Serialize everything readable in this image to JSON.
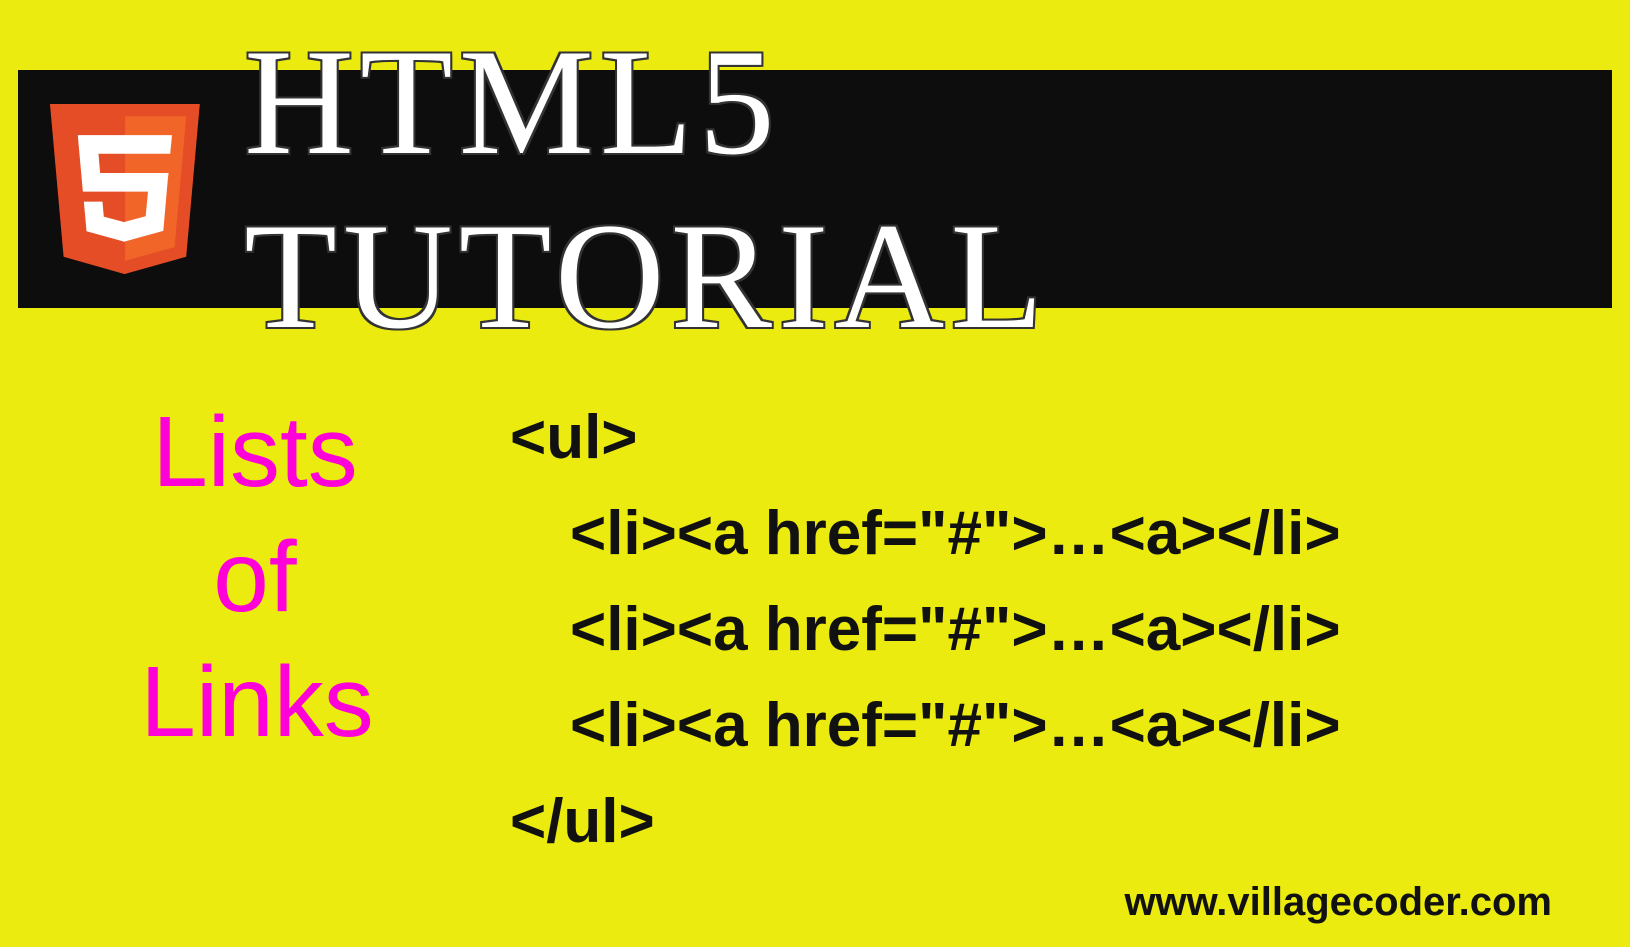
{
  "header": {
    "title": "HTML5 TUTORIAL",
    "logo_glyph": "5"
  },
  "subtitle": {
    "line1": "Lists",
    "line2": "of",
    "line3": "Links"
  },
  "code": {
    "open": "<ul>",
    "li1": "<li><a href=\"#\">…<a></li>",
    "li2": "<li><a href=\"#\">…<a></li>",
    "li3": "<li><a href=\"#\">…<a></li>",
    "close": "</ul>"
  },
  "footer": {
    "url": "www.villagecoder.com"
  },
  "colors": {
    "background": "#ebeb0f",
    "header_bg": "#0d0d0d",
    "accent": "#ff00d9",
    "logo": "#e44d26"
  }
}
